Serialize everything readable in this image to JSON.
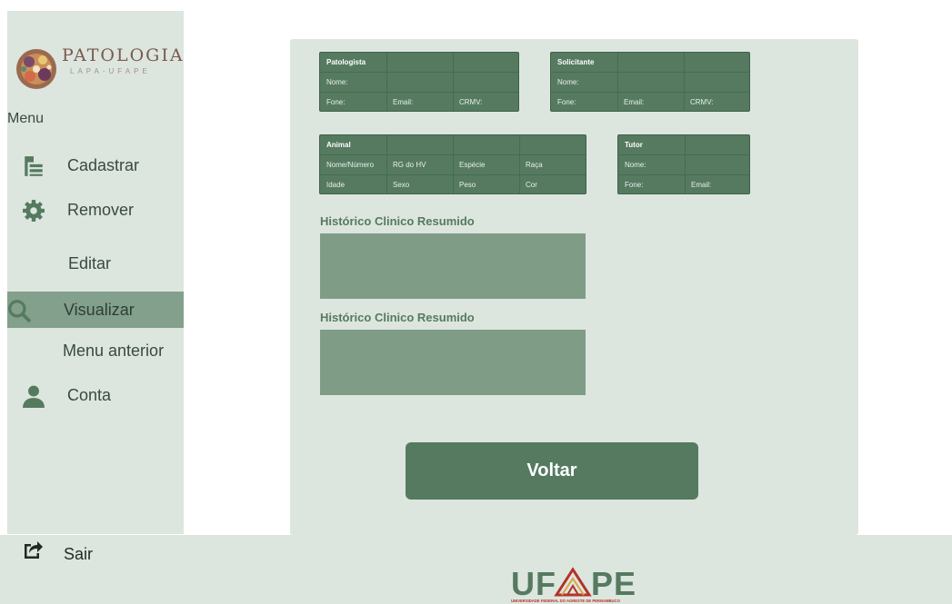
{
  "brand": {
    "title": "PATOLOGIA",
    "subtitle": "LAPA-UFAPE"
  },
  "sidebar": {
    "menu_heading": "Menu",
    "items": [
      {
        "label": "Cadastrar",
        "icon": "document-add-icon"
      },
      {
        "label": "Remover",
        "icon": "gear-icon"
      },
      {
        "label": "Editar",
        "icon": ""
      },
      {
        "label": "Visualizar",
        "icon": "search-icon",
        "active": true
      },
      {
        "label": "Menu anterior",
        "icon": ""
      },
      {
        "label": "Conta",
        "icon": "user-icon"
      }
    ],
    "logout_label": "Sair"
  },
  "patologista": {
    "title": "Patologista",
    "nome": "Nome:",
    "fone": "Fone:",
    "email": "Email:",
    "crmv": "CRMV:"
  },
  "solicitante": {
    "title": "Solicitante",
    "nome": "Nome:",
    "fone": "Fone:",
    "email": "Email:",
    "crmv": "CRMV:"
  },
  "animal": {
    "title": "Animal",
    "nome": "Nome/Número",
    "rg": "RG do HV",
    "especie": "Espécie",
    "raca": "Raça",
    "idade": "Idade",
    "sexo": "Sexo",
    "peso": "Peso",
    "cor": "Cor"
  },
  "tutor": {
    "title": "Tutor",
    "nome": "Nome:",
    "fone": "Fone:",
    "email": "Email:"
  },
  "sections": [
    {
      "title": "Histórico Clinico Resumido",
      "value": ""
    },
    {
      "title": "Histórico Clinico Resumido",
      "value": ""
    }
  ],
  "voltar_label": "Voltar",
  "footer_logo": {
    "text": "UFAPE",
    "tagline": "UNIVERSIDADE FEDERAL DO AGRESTE DE PERNAMBUCO"
  },
  "colors": {
    "accent": "#557a60",
    "panel": "#dce6de",
    "active": "#82a08b",
    "box": "#7f9c87",
    "logo_text": "#7b5a4e",
    "ufape_red": "#b5322a"
  }
}
